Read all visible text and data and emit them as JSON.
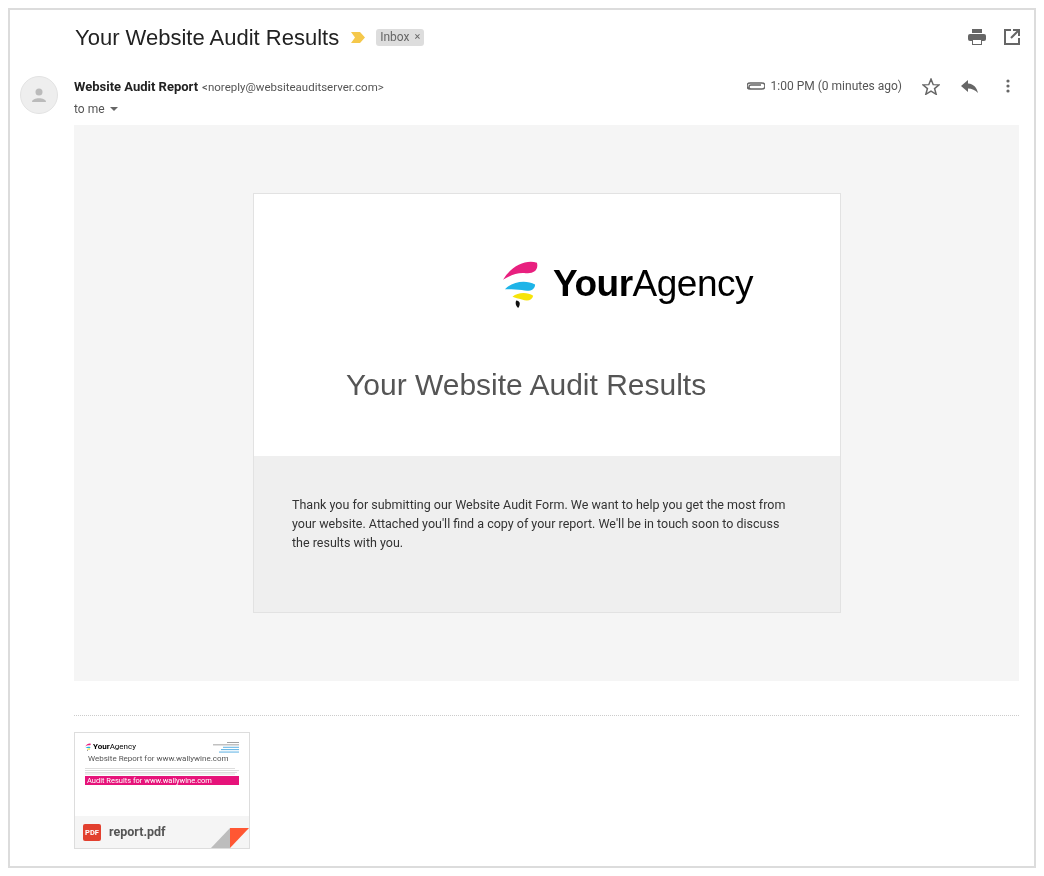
{
  "subject": "Your Website Audit Results",
  "important": true,
  "label": {
    "text": "Inbox",
    "remove": "×"
  },
  "sender": {
    "name": "Website Audit Report",
    "email": "<noreply@websiteauditserver.com>",
    "recipient": "to me"
  },
  "time": "1:00 PM (0 minutes ago)",
  "has_attachment": true,
  "starred": false,
  "message": {
    "logo": "**Your**Agency",
    "heading": "Your Website Audit Results",
    "body": "Thank you for submitting our Website Audit Form. We want to help you get the most from your website. Attached you'll find a copy of your report. We'll be in touch soon to discuss the results with you."
  },
  "attachments": [
    {
      "file_name": "report.pdf",
      "file_type": "PDF",
      "preview": {
        "logo": "**Your**Agency",
        "title": "Website Report for www.wallywine.com",
        "banner": "Audit Results for www.wallywine.com"
      }
    }
  ]
}
